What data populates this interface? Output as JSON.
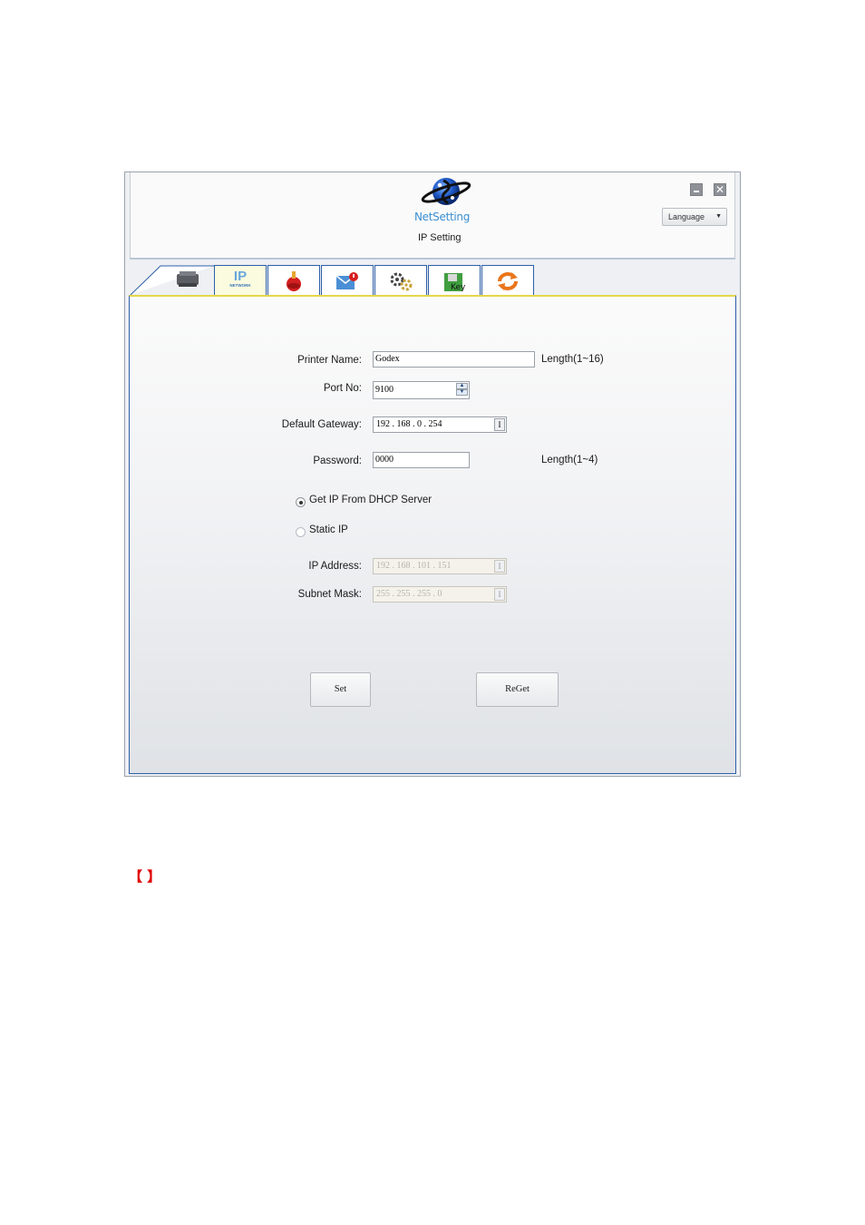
{
  "header": {
    "app_name": "NetSetting",
    "subtitle": "IP Setting",
    "language_label": "Language",
    "close_glyph": "✕"
  },
  "tabs": [
    {
      "name": "printer",
      "icon": "printer-icon"
    },
    {
      "name": "ip-network",
      "icon": "ip-network-icon",
      "label": "IP",
      "sub": "NETWORK",
      "active": true
    },
    {
      "name": "alert",
      "icon": "alarm-icon"
    },
    {
      "name": "email",
      "icon": "mail-alert-icon"
    },
    {
      "name": "settings",
      "icon": "gears-icon"
    },
    {
      "name": "key",
      "icon": "key-icon"
    },
    {
      "name": "refresh",
      "icon": "refresh-icon"
    }
  ],
  "form": {
    "printer_name": {
      "label": "Printer Name:",
      "value": "Godex",
      "hint": "Length(1~16)"
    },
    "port_no": {
      "label": "Port No:",
      "value": "9100"
    },
    "gateway": {
      "label": "Default Gateway:",
      "value": "192 . 168 . 0 . 254"
    },
    "password": {
      "label": "Password:",
      "value": "0000",
      "hint": "Length(1~4)"
    },
    "dhcp": {
      "label": "Get IP From DHCP Server",
      "checked": true
    },
    "static": {
      "label": "Static IP",
      "checked": false
    },
    "ip_address": {
      "label": "IP Address:",
      "value": "192 . 168 . 101 . 151"
    },
    "subnet_mask": {
      "label": "Subnet Mask:",
      "value": "255 . 255 . 255 . 0"
    },
    "ip_button_glyph": "I"
  },
  "buttons": {
    "set": "Set",
    "reget": "ReGet"
  },
  "footer": {
    "brackets": "【    】"
  },
  "colors": {
    "tab_border": "#2f5fa8",
    "active_tab_bg": "#fbfbe0",
    "accent_line": "#e6d74a"
  }
}
